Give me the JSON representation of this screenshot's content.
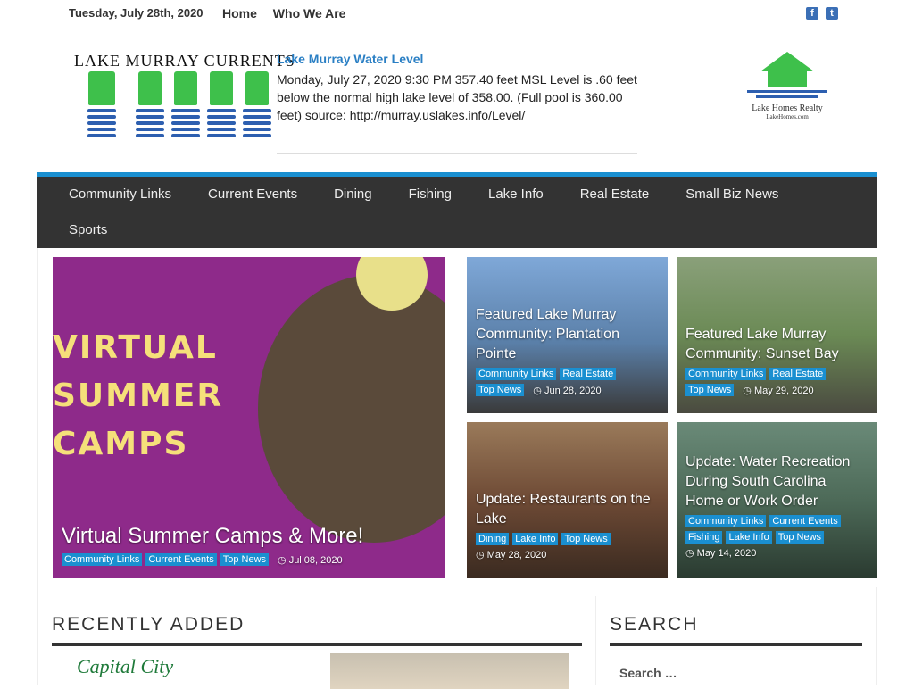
{
  "topbar": {
    "date": "Tuesday, July 28th, 2020",
    "nav": [
      "Home",
      "Who We Are"
    ],
    "social": [
      "facebook-icon",
      "twitter-icon"
    ]
  },
  "logo": {
    "title": "LAKE MURRAY CURRENTS"
  },
  "water": {
    "heading": "Lake Murray Water Level",
    "body": "Monday, July 27, 2020 9:30 PM 357.40 feet MSL Level is .60 feet below the normal high lake level of 358.00. (Full pool is 360.00 feet) source: http://murray.uslakes.info/Level/"
  },
  "realty": {
    "name": "Lake Homes Realty",
    "sub": "LakeHomes.com"
  },
  "mainnav": [
    "Community Links",
    "Current Events",
    "Dining",
    "Fishing",
    "Lake Info",
    "Real Estate",
    "Small Biz News",
    "Sports"
  ],
  "tiles": [
    {
      "title": "Virtual Summer Camps & More!",
      "image_text": "VIRTUAL SUMMER CAMPS",
      "tags": [
        "Community Links",
        "Current Events",
        "Top News"
      ],
      "date": "Jul 08, 2020",
      "color": "#8e2a8a"
    },
    {
      "title": "Featured Lake Murray Community: Plantation Pointe",
      "tags": [
        "Community Links",
        "Real Estate",
        "Top News"
      ],
      "date": "Jun 28, 2020",
      "color": "#5a7fa8"
    },
    {
      "title": "Featured Lake Murray Community: Sunset Bay",
      "tags": [
        "Community Links",
        "Real Estate",
        "Top News"
      ],
      "date": "May 29, 2020",
      "color": "#6b8a55"
    },
    {
      "title": "Update: Restaurants on the Lake",
      "tags": [
        "Dining",
        "Lake Info",
        "Top News"
      ],
      "date": "May 28, 2020",
      "color": "#6e4a35"
    },
    {
      "title": "Update: Water Recreation During South Carolina Home or Work Order",
      "tags": [
        "Community Links",
        "Current Events",
        "Fishing",
        "Lake Info",
        "Top News"
      ],
      "date": "May 14, 2020",
      "color": "#4d6a58"
    }
  ],
  "sections": {
    "recent": "RECENTLY ADDED",
    "search": "SEARCH",
    "search_placeholder": "Search …",
    "recent_logo": "Capital City"
  }
}
